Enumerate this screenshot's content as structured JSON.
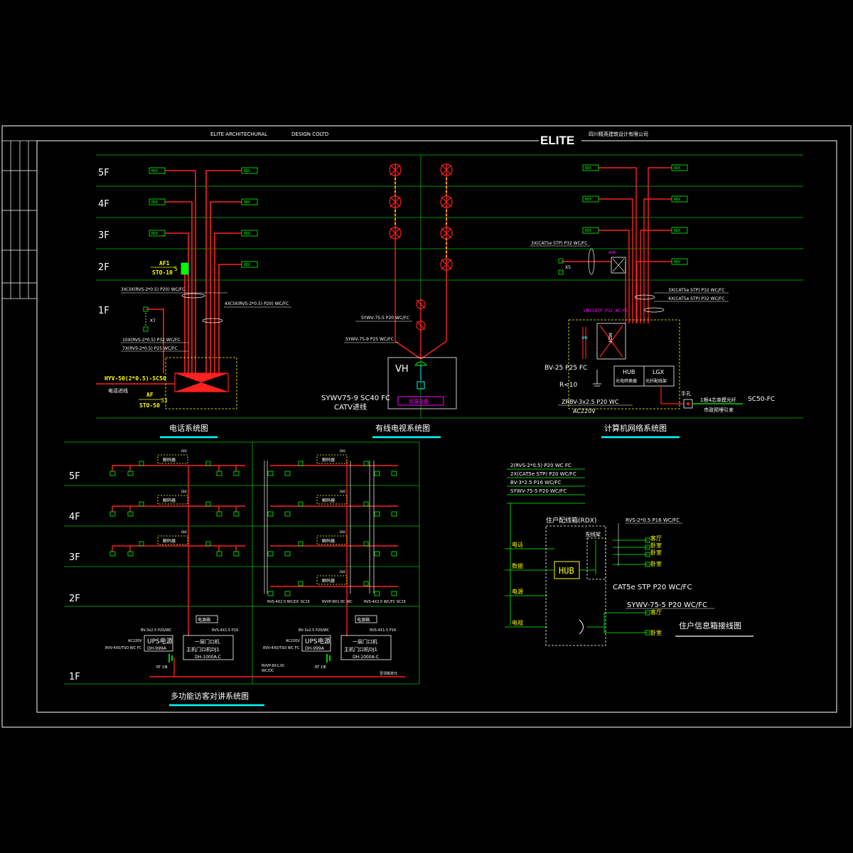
{
  "header": {
    "firm_en_1": "ELITE  ARCHITECHURAL",
    "firm_en_2": "DESIGN    COLTD",
    "logo": "ELITE",
    "firm_cn": "四川精英建筑设计有限公司"
  },
  "floors": [
    "5F",
    "4F",
    "3F",
    "2F",
    "1F"
  ],
  "phone": {
    "title": "电话系统图",
    "box_label": "RDX",
    "af1": "AF1",
    "sto10": "STO-10",
    "num5": "5",
    "cable_3x": "3X(3X(RVS-2*0.5) P20) WC/FC",
    "cable_4x": "4X(3X(RVS-2*0.5) P20) WC/FC",
    "x7": "X7",
    "cable_10x": "10X(RVS-2*0.5) P32 WC/FC",
    "cable_7x": "7X(RVS-2*0.5) P25 WC/FC",
    "hyv": "HYV-50(2*0.5)-SC50",
    "incoming": "电话进线",
    "af": "AF",
    "sto50": "STO-50",
    "num33": "33"
  },
  "catv": {
    "title": "有线电视系统图",
    "sywv_p20": "SYWV-75-5 P20 WC/FC",
    "sywv_p25": "SYWV-75-9 P25 WC/FC",
    "vh": "VH",
    "front_device": "前端设备",
    "sc40": "SYWV75-9 SC40 FC",
    "catv_in": "CATV进线"
  },
  "network": {
    "title": "计算机网络系统图",
    "box_label": "RDX",
    "cat5_3x": "3X(CAT5e STP) P32 WC/FC",
    "x5": "X5",
    "ahk": "AHK",
    "cat5_3x_b": "3X(CAT5e STP) P32 WC/FC",
    "cat5_4x": "4X(CAT5e STP) P32 WC/FC",
    "fiber": "1根CENTP P32 WC/FC",
    "mdf": "MDF",
    "hub": "HUB",
    "hub_cn": "光电转换器",
    "lgx": "LGX",
    "lgx_cn": "光纤配线架",
    "bv25": "BV-25 P25 FC",
    "r10": "R<10",
    "zrbv": "ZRBV-3x2.5 P20 WC",
    "ac220": "AC220V",
    "hand": "手孔",
    "fiber_in": "1根4芯单模光纤",
    "fiber_in2": "市政预埋引来",
    "sc50": "SC50-FC"
  },
  "intercom": {
    "title": "多功能访客对讲系统图",
    "decoder": "解码器",
    "dbc": "DBC",
    "rvs_l": "RVS-4X2.5 WC/DC SC15",
    "rvvp": "RVVP-8X1.0C WC",
    "rvs_r": "RVS-4X2.5 WC/FC SC15",
    "power_box": "电源箱",
    "ups": "UPS电源",
    "dh999": "DH-999A",
    "door_phone": "一层门口机",
    "main_phone": "主机门口机DJ1",
    "dh1000": "DH-1000A-C",
    "ac220": "AC220V",
    "bv_a": "BV-3x2.5 P20/WC",
    "rvs_a": "RVS-4X1.5 P16",
    "rvv": "RVV-4X0/TSO WC FC",
    "rt1": "RT 1米",
    "rvvp2": "RVVP-8X1.0C",
    "wc": "WC/DC",
    "to_next": "至邻栋单元"
  },
  "info": {
    "title": "住户信息箱接线图",
    "leg1": "2(RVS-2*0.5) P20 WC FC",
    "leg2": "2X(CAT5e STP) P20 WC/FC",
    "leg3": "BV-3*2.5 P16 WC/FC",
    "leg4": "SYWV-75-5 P20 WC/FC",
    "box": "住户配线箱(RDX)",
    "rack": "配线架",
    "rvs": "RVS-2*0.5 P16 WC/FC",
    "phone": "电话",
    "data": "数据",
    "power": "电源",
    "tv": "电视",
    "hub": "HUB",
    "living": "客厅",
    "bedroom": "卧室",
    "cat5": "CAT5e  STP  P20  WC/FC",
    "sywv": "SYWV-75-5  P20  WC/FC",
    "living2": "客厅",
    "bedroom2": "卧室"
  }
}
